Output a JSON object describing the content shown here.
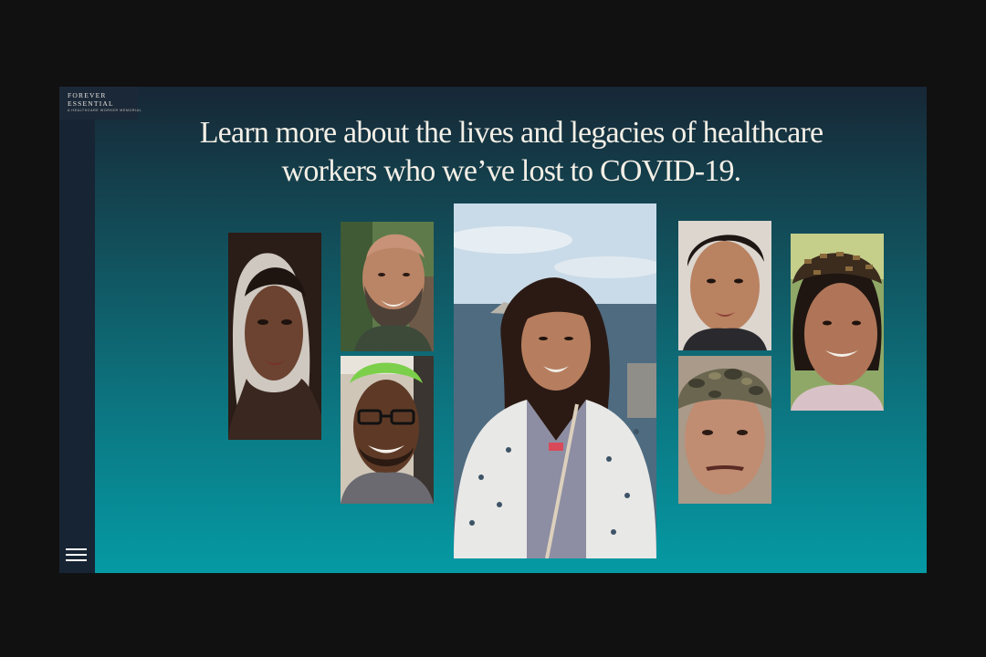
{
  "logo": {
    "line1": "FOREVER",
    "line2": "ESSENTIAL",
    "tagline": "A HEALTHCARE WORKER MEMORIAL"
  },
  "headline": "Learn more about the lives and legacies of healthcare workers who we’ve lost to COVID-19.",
  "menu_icon": "hamburger-menu-icon",
  "photos": [
    {
      "name": "portrait-woman-curly-hair",
      "icon": "portrait"
    },
    {
      "name": "portrait-bald-man-beard",
      "icon": "portrait"
    },
    {
      "name": "portrait-man-glasses",
      "icon": "portrait"
    },
    {
      "name": "portrait-woman-by-sea",
      "icon": "portrait"
    },
    {
      "name": "portrait-young-man",
      "icon": "portrait"
    },
    {
      "name": "portrait-man-camo-cap",
      "icon": "portrait"
    },
    {
      "name": "portrait-woman-patterned-hat",
      "icon": "portrait"
    }
  ]
}
